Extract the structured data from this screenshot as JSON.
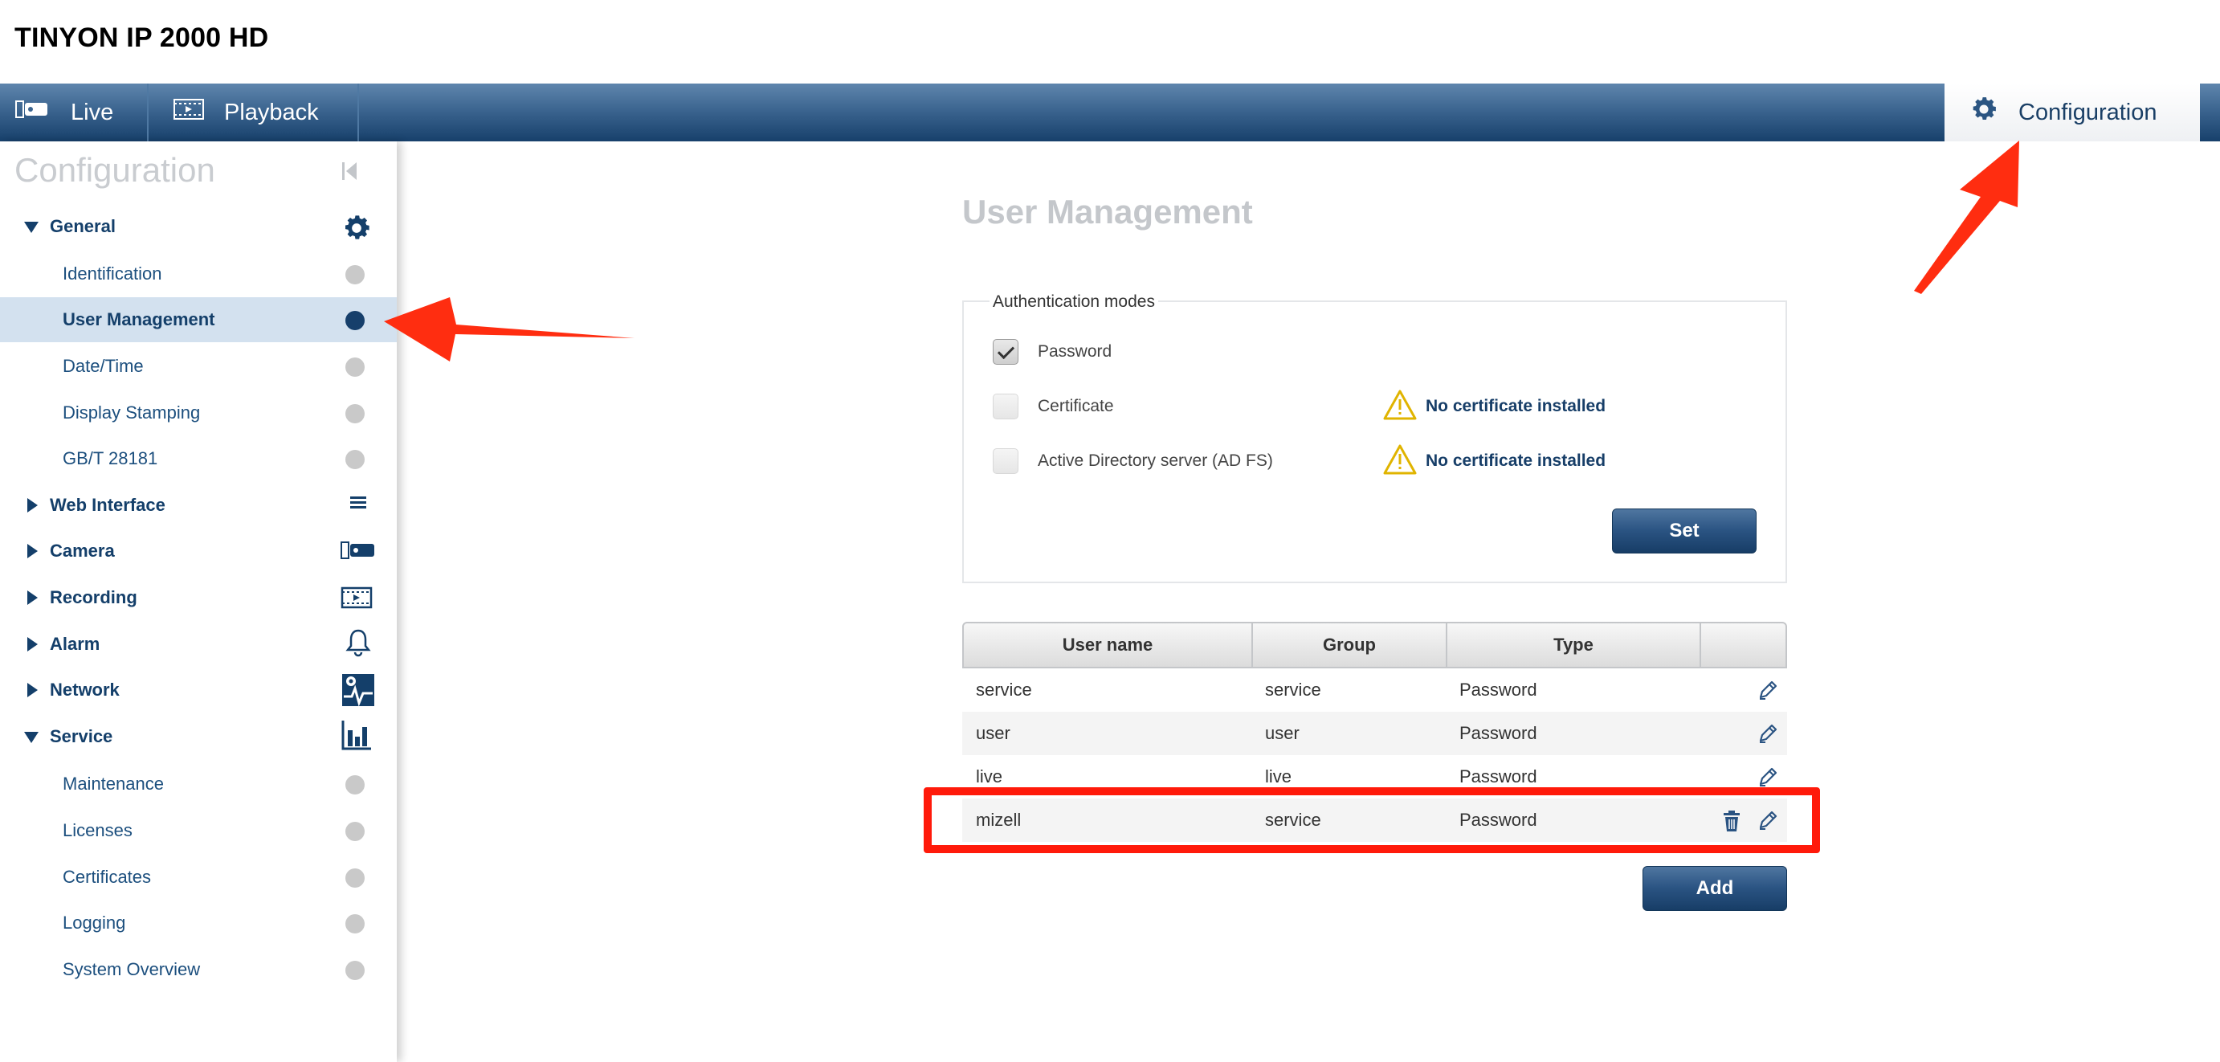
{
  "app": {
    "title": "TINYON IP 2000 HD"
  },
  "topnav": {
    "live": "Live",
    "playback": "Playback",
    "configuration": "Configuration"
  },
  "sidebar": {
    "header": "Configuration",
    "items": [
      {
        "label": "General",
        "type": "group",
        "expanded": true,
        "icon": "gear-icon"
      },
      {
        "label": "Identification",
        "type": "sub"
      },
      {
        "label": "User Management",
        "type": "sub",
        "active": true
      },
      {
        "label": "Date/Time",
        "type": "sub"
      },
      {
        "label": "Display Stamping",
        "type": "sub"
      },
      {
        "label": "GB/T 28181",
        "type": "sub"
      },
      {
        "label": "Web Interface",
        "type": "group",
        "expanded": false,
        "icon": "list-icon"
      },
      {
        "label": "Camera",
        "type": "group",
        "expanded": false,
        "icon": "camera-icon"
      },
      {
        "label": "Recording",
        "type": "group",
        "expanded": false,
        "icon": "recording-icon"
      },
      {
        "label": "Alarm",
        "type": "group",
        "expanded": false,
        "icon": "bell-icon"
      },
      {
        "label": "Network",
        "type": "group",
        "expanded": false,
        "icon": "network-icon"
      },
      {
        "label": "Service",
        "type": "group",
        "expanded": true,
        "icon": "bar-chart-icon"
      },
      {
        "label": "Maintenance",
        "type": "sub"
      },
      {
        "label": "Licenses",
        "type": "sub"
      },
      {
        "label": "Certificates",
        "type": "sub"
      },
      {
        "label": "Logging",
        "type": "sub"
      },
      {
        "label": "System Overview",
        "type": "sub"
      }
    ]
  },
  "main": {
    "title": "User Management",
    "auth": {
      "legend": "Authentication modes",
      "modes": [
        {
          "label": "Password",
          "checked": true,
          "warning": ""
        },
        {
          "label": "Certificate",
          "checked": false,
          "warning": "No certificate installed"
        },
        {
          "label": "Active Directory server (AD FS)",
          "checked": false,
          "warning": "No certificate installed"
        }
      ],
      "set_label": "Set"
    },
    "table": {
      "columns": [
        "User name",
        "Group",
        "Type",
        ""
      ],
      "rows": [
        {
          "user": "service",
          "group": "service",
          "type": "Password",
          "deletable": false
        },
        {
          "user": "user",
          "group": "user",
          "type": "Password",
          "deletable": false
        },
        {
          "user": "live",
          "group": "live",
          "type": "Password",
          "deletable": false
        },
        {
          "user": "mizell",
          "group": "service",
          "type": "Password",
          "deletable": true
        }
      ]
    },
    "add_label": "Add"
  },
  "colors": {
    "nav_dark": "#17406b",
    "accent_text": "#143f6a",
    "active_bg": "#d3e1ef",
    "annotation_red": "#ff1a0a"
  }
}
